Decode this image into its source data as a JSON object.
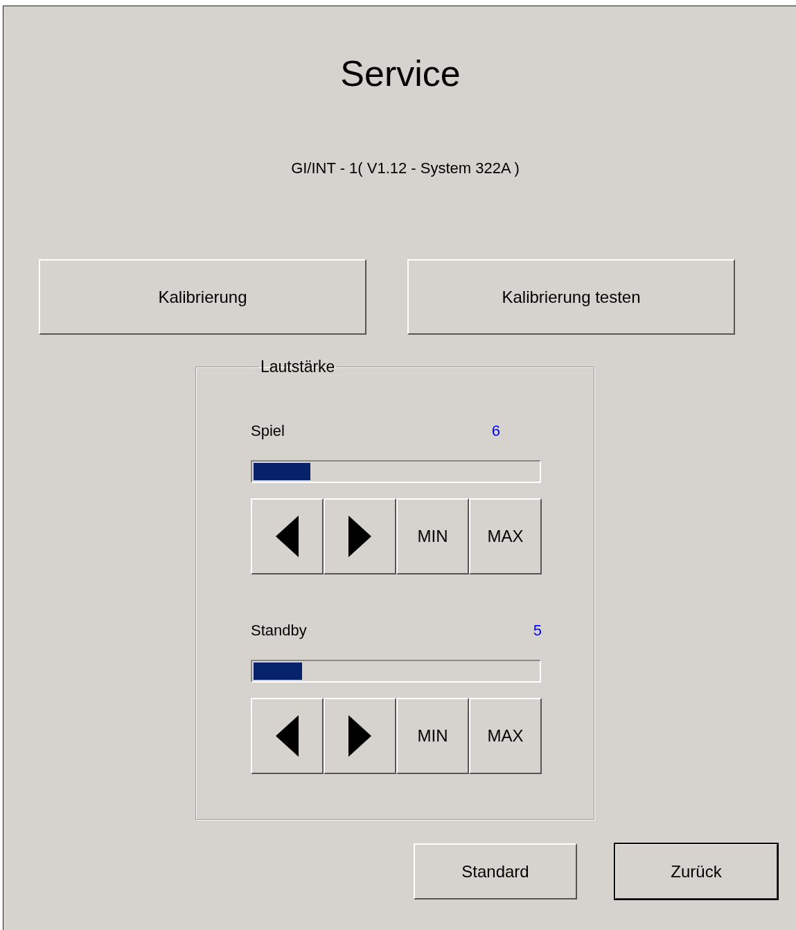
{
  "title": "Service",
  "subtitle": "GI/INT - 1( V1.12 - System 322A )",
  "top_buttons": [
    "Kalibrierung",
    "Kalibrierung testen"
  ],
  "group": {
    "label": "Lautstärke",
    "channels": [
      {
        "name": "Spiel",
        "value": "6",
        "level": 0.2,
        "buttons": [
          {
            "kind": "left"
          },
          {
            "kind": "right"
          },
          {
            "kind": "text",
            "label": "MIN"
          },
          {
            "kind": "text",
            "label": "MAX"
          }
        ]
      },
      {
        "name": "Standby",
        "value": "5",
        "level": 0.17,
        "buttons": [
          {
            "kind": "left"
          },
          {
            "kind": "right"
          },
          {
            "kind": "text",
            "label": "MIN"
          },
          {
            "kind": "text",
            "label": "MAX"
          }
        ]
      }
    ]
  },
  "bottom_buttons": [
    {
      "label": "Standard",
      "default": false
    },
    {
      "label": "Zurück",
      "default": true
    }
  ]
}
